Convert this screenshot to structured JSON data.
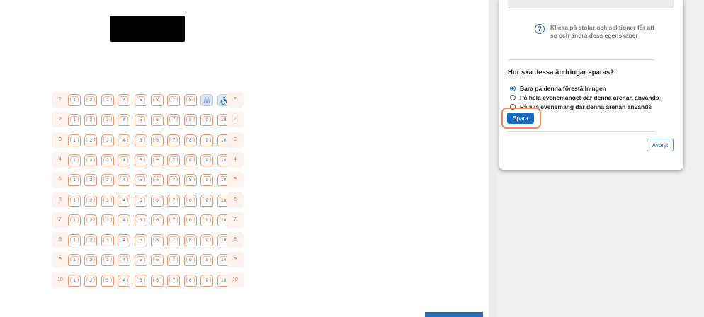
{
  "stage": {
    "label": ""
  },
  "seatmap": {
    "rows": [
      "1",
      "2",
      "3",
      "4",
      "5",
      "6",
      "7",
      "8",
      "9",
      "10"
    ],
    "seats": [
      "1",
      "2",
      "3",
      "4",
      "5",
      "6",
      "7",
      "8",
      "9",
      "10"
    ],
    "row1_special": {
      "9": "companion-seat-icon",
      "10": "wheelchair-icon"
    },
    "seat_color": "#f3956c",
    "label_color": "#e47b4e"
  },
  "panel": {
    "hint_text": "Klicka på stolar och sektioner för att se och ändra dess egenskaper",
    "question": "Hur ska dessa ändringar sparas?",
    "options": [
      {
        "label": "Bara på denna föreställningen",
        "checked": true
      },
      {
        "label": "På hela evenemanget där denna arenan används",
        "checked": false
      },
      {
        "label": "På alla evenemang där denna arenan används",
        "checked": false
      }
    ],
    "save_label": "Spara",
    "cancel_label": "Avbryt",
    "accent_color": "#1a6bbf",
    "highlight_color": "#f08a5d"
  }
}
